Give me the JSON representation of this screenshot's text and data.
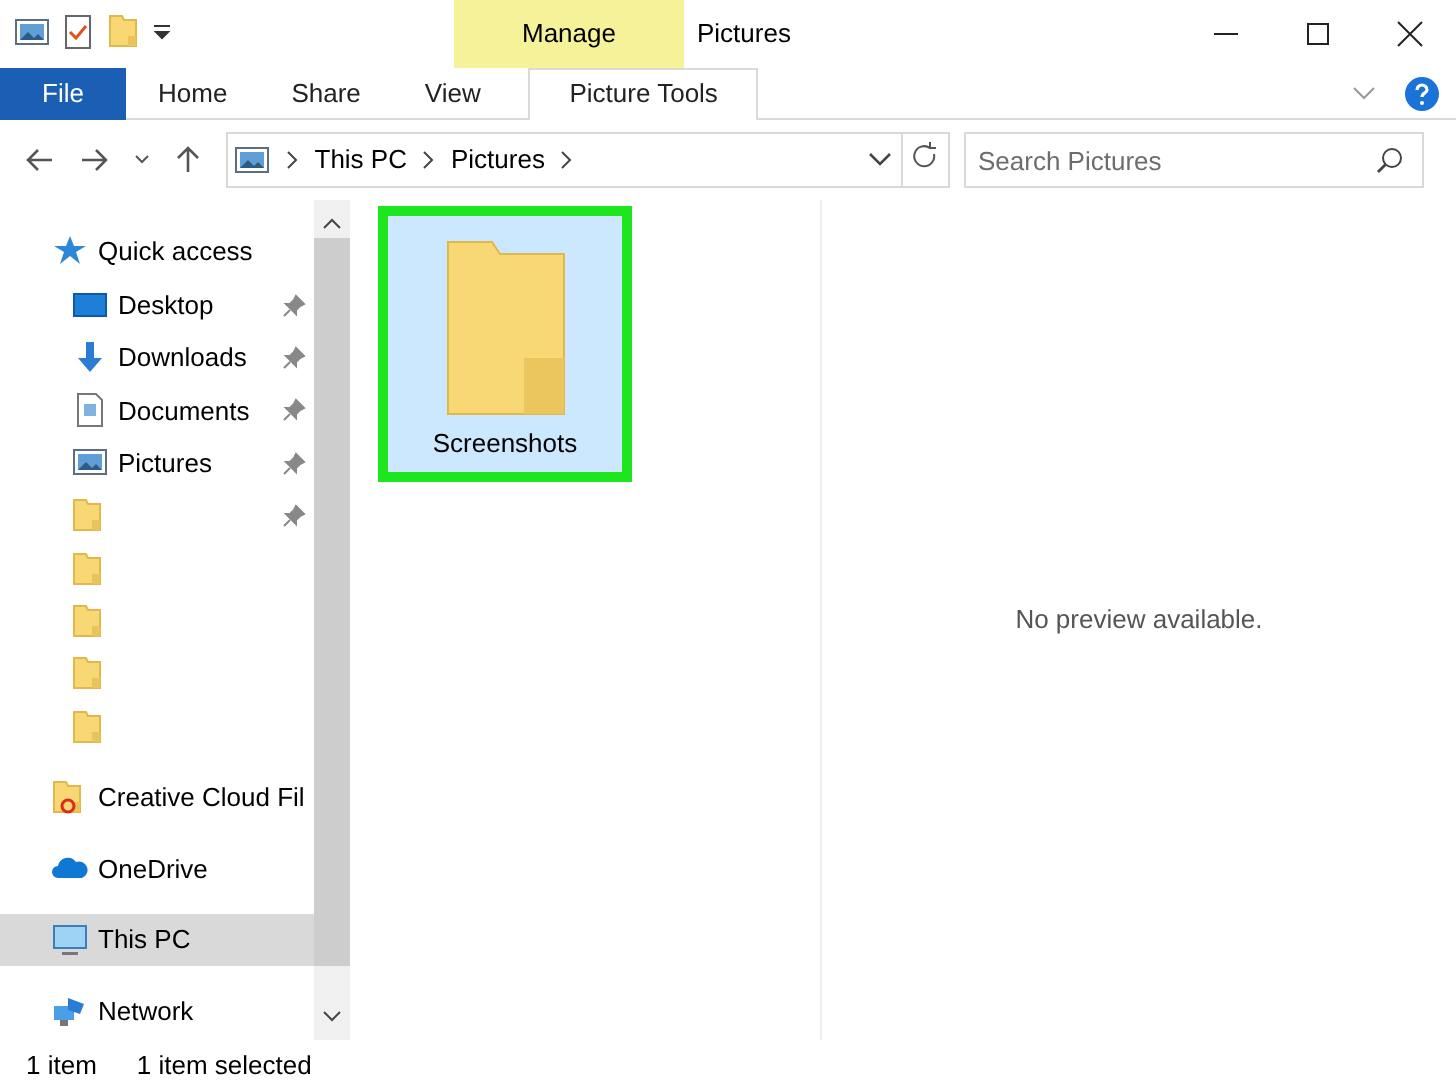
{
  "window": {
    "title": "Pictures",
    "context_tab": "Manage"
  },
  "ribbon": {
    "tabs": [
      {
        "label": "File",
        "kind": "file",
        "selected": false
      },
      {
        "label": "Home",
        "kind": "tab",
        "selected": false
      },
      {
        "label": "Share",
        "kind": "tab",
        "selected": false
      },
      {
        "label": "View",
        "kind": "tab",
        "selected": false
      },
      {
        "label": "Picture Tools",
        "kind": "context",
        "selected": false
      }
    ]
  },
  "address": {
    "path": [
      "This PC",
      "Pictures"
    ],
    "search_placeholder": "Search Pictures"
  },
  "sidebar": {
    "items": [
      {
        "label": "Quick access",
        "kind": "star",
        "group": true,
        "pinned": false,
        "selected": false
      },
      {
        "label": "Desktop",
        "kind": "desktop",
        "group": false,
        "pinned": true,
        "selected": false
      },
      {
        "label": "Downloads",
        "kind": "download",
        "group": false,
        "pinned": true,
        "selected": false
      },
      {
        "label": "Documents",
        "kind": "document",
        "group": false,
        "pinned": true,
        "selected": false
      },
      {
        "label": "Pictures",
        "kind": "picture",
        "group": false,
        "pinned": true,
        "selected": false
      },
      {
        "kind": "folder",
        "group": false,
        "pinned": true,
        "selected": false
      },
      {
        "kind": "folder",
        "group": false,
        "pinned": false,
        "selected": false
      },
      {
        "kind": "folder",
        "group": false,
        "pinned": false,
        "selected": false
      },
      {
        "kind": "folder",
        "group": false,
        "pinned": false,
        "selected": false
      },
      {
        "kind": "folder",
        "group": false,
        "pinned": false,
        "selected": false
      },
      {
        "label": "Creative Cloud Fil",
        "kind": "cloudfolder",
        "group": true,
        "pinned": false,
        "selected": false
      },
      {
        "label": "OneDrive",
        "kind": "cloud",
        "group": true,
        "pinned": false,
        "selected": false
      },
      {
        "label": "This PC",
        "kind": "pc",
        "group": true,
        "pinned": false,
        "selected": true
      },
      {
        "label": "Network",
        "kind": "network",
        "group": true,
        "pinned": false,
        "selected": false
      }
    ]
  },
  "files": [
    {
      "name": "Screenshots",
      "selected": true,
      "highlighted": true
    }
  ],
  "preview": {
    "message": "No preview available."
  },
  "status_bar": {
    "count": "1 item",
    "selection": "1 item selected"
  }
}
